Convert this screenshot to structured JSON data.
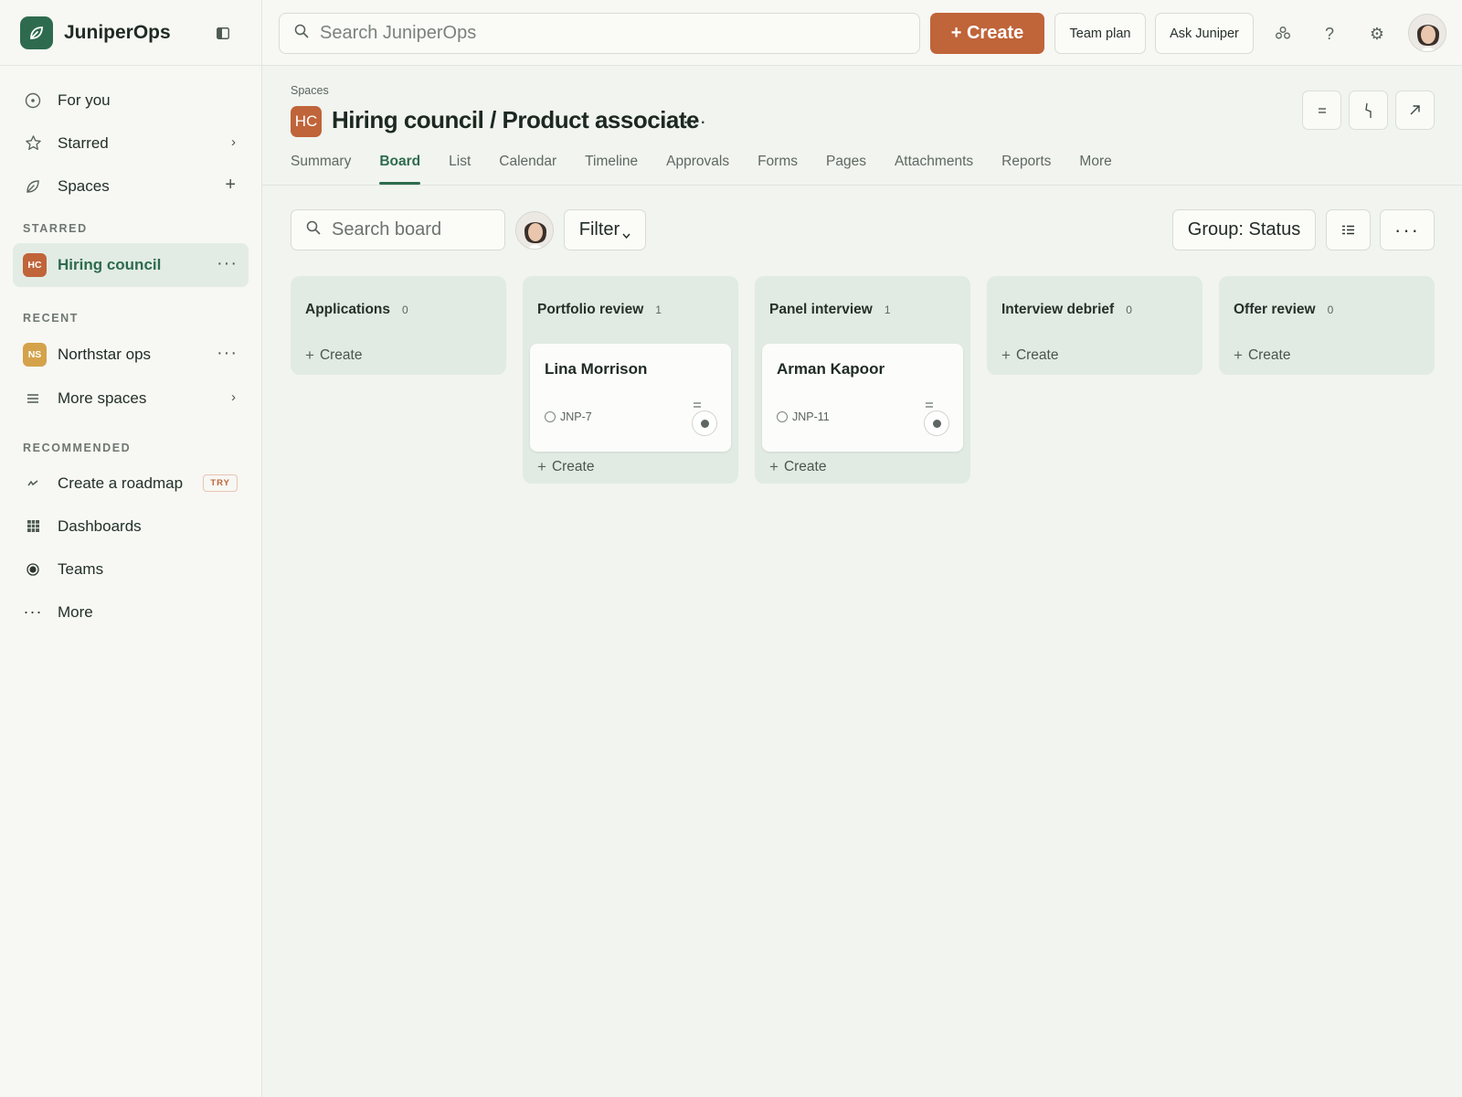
{
  "brand": {
    "name": "JuniperOps",
    "accent": "#2e6b4e"
  },
  "nav": {
    "items": [
      {
        "label": "For you",
        "icon": "target-icon"
      },
      {
        "label": "Starred",
        "icon": "star-icon",
        "trail": "›"
      },
      {
        "label": "Spaces",
        "icon": "leaf-icon",
        "trail": "+"
      }
    ]
  },
  "sidebar": {
    "starred_label": "STARRED",
    "starred": [
      {
        "badge": "HC",
        "label": "Hiring council",
        "color": "#c0643a",
        "active": true
      }
    ],
    "recent_label": "RECENT",
    "recent": [
      {
        "badge": "NS",
        "label": "Northstar ops",
        "color": "#d4a24a"
      }
    ],
    "more_spaces": "More spaces",
    "recommended_label": "RECOMMENDED",
    "recommended": [
      {
        "label": "Create a roadmap",
        "icon": "roadmap-icon",
        "badge": "TRY"
      },
      {
        "label": "Dashboards",
        "icon": "grid-icon"
      },
      {
        "label": "Teams",
        "icon": "teams-icon"
      },
      {
        "label": "More",
        "icon": "more-dots-icon"
      }
    ]
  },
  "topbar": {
    "search_placeholder": "Search JuniperOps",
    "create_label": "+ Create",
    "team_plan": "Team plan",
    "ask_juniper": "Ask Juniper"
  },
  "header": {
    "breadcrumb": "Spaces",
    "badge": "HC",
    "title": "Hiring council / Product associate",
    "more": "···"
  },
  "tabs": [
    "Summary",
    "Board",
    "List",
    "Calendar",
    "Timeline",
    "Approvals",
    "Forms",
    "Pages",
    "Attachments",
    "Reports",
    "More"
  ],
  "active_tab": "Board",
  "toolbar": {
    "search_placeholder": "Search board",
    "filter_label": "Filter",
    "group_label": "Group: Status"
  },
  "board": {
    "create_label": "Create",
    "columns": [
      {
        "name": "Applications",
        "count": "0",
        "cards": []
      },
      {
        "name": "Portfolio review",
        "count": "1",
        "cards": [
          {
            "title": "Lina Morrison",
            "key": "JNP-7"
          }
        ]
      },
      {
        "name": "Panel interview",
        "count": "1",
        "cards": [
          {
            "title": "Arman Kapoor",
            "key": "JNP-11"
          }
        ]
      },
      {
        "name": "Interview debrief",
        "count": "0",
        "cards": []
      },
      {
        "name": "Offer review",
        "count": "0",
        "cards": []
      }
    ]
  }
}
